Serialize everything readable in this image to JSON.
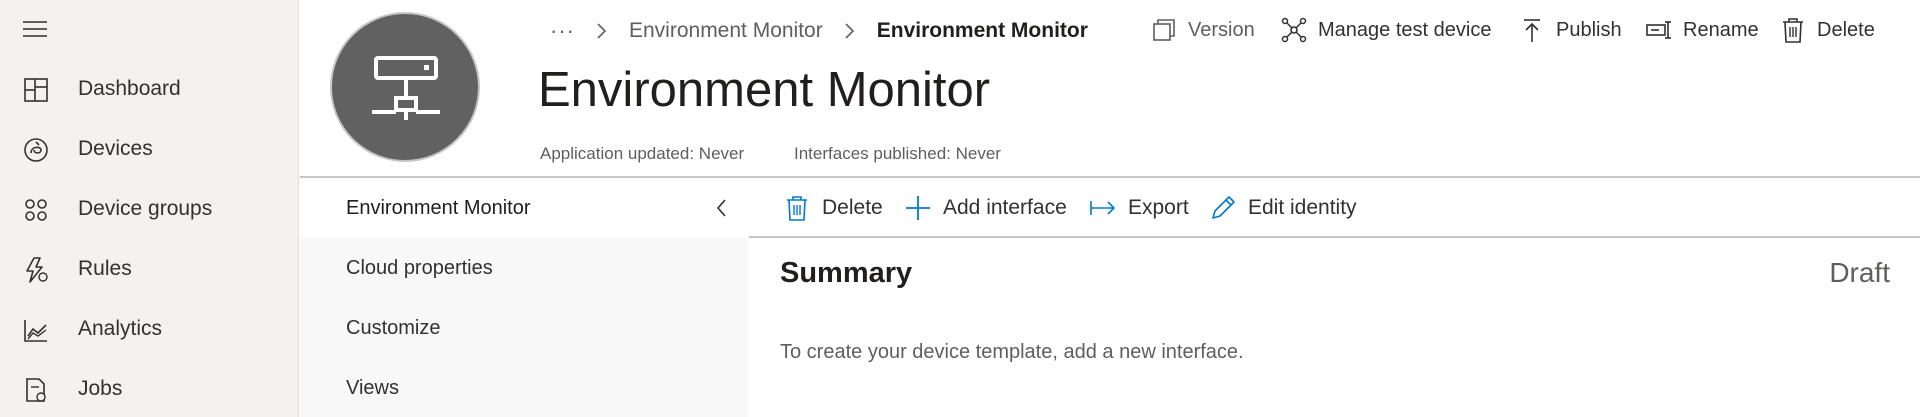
{
  "nav": {
    "items": [
      {
        "label": "Dashboard",
        "icon": "dashboard-icon"
      },
      {
        "label": "Devices",
        "icon": "devices-icon"
      },
      {
        "label": "Device groups",
        "icon": "device-groups-icon"
      },
      {
        "label": "Rules",
        "icon": "rules-icon"
      },
      {
        "label": "Analytics",
        "icon": "analytics-icon"
      },
      {
        "label": "Jobs",
        "icon": "jobs-icon"
      }
    ]
  },
  "header": {
    "breadcrumb": {
      "more": "···",
      "items": [
        "Environment Monitor",
        "Environment Monitor"
      ]
    },
    "title": "Environment Monitor",
    "meta": {
      "app_updated": "Application updated: Never",
      "interfaces_published": "Interfaces published: Never"
    },
    "commands": {
      "version": "Version",
      "manage_test_device": "Manage test device",
      "publish": "Publish",
      "rename": "Rename",
      "delete": "Delete"
    }
  },
  "subnav": {
    "items": [
      "Environment Monitor",
      "Cloud properties",
      "Customize",
      "Views"
    ]
  },
  "toolbar": {
    "delete": "Delete",
    "add_interface": "Add interface",
    "export": "Export",
    "edit_identity": "Edit identity"
  },
  "main": {
    "summary_title": "Summary",
    "status": "Draft",
    "hint": "To create your device template, add a new interface."
  },
  "colors": {
    "accent": "#0078d4",
    "nav_bg": "#f3f2f1",
    "avatar_bg": "#616161"
  }
}
